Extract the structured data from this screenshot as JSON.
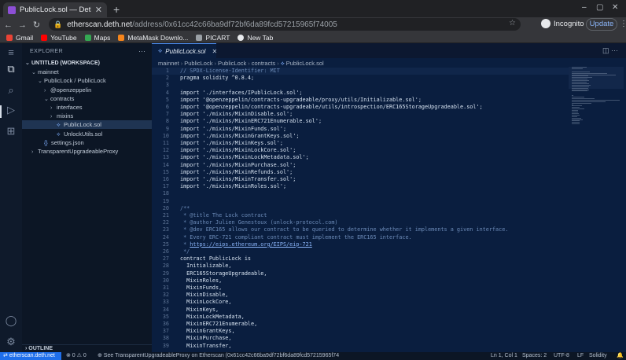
{
  "browser": {
    "tab_title": "PublicLock.sol — DethCode",
    "tab_close": "✕",
    "new_tab": "+",
    "window_controls": {
      "minimize": "–",
      "maximize": "▢",
      "close": "✕"
    },
    "nav": {
      "back": "←",
      "forward": "→",
      "reload": "↻"
    },
    "url_host": "etherscan.deth.net",
    "url_path": "/address/0x61cc42c66ba9df72bf6da89fcd57215965f74005",
    "omnibox_icons": "☆",
    "incognito_label": "Incognito",
    "update_label": "Update",
    "menu": "⋮",
    "bookmarks": [
      {
        "label": "Gmail",
        "color": "#ea4335"
      },
      {
        "label": "YouTube",
        "color": "#ff0000"
      },
      {
        "label": "Maps",
        "color": "#34a853"
      },
      {
        "label": "MetaMask Downlo...",
        "color": "#f6851b"
      },
      {
        "label": "PICART",
        "color": "#9aa0a6"
      },
      {
        "label": "New Tab",
        "color": "#e8eaed"
      }
    ]
  },
  "sidebar": {
    "header": "EXPLORER",
    "dots": "···",
    "rows": [
      {
        "twisty": "⌄",
        "label": "UNTITLED (WORKSPACE)",
        "indent": 0,
        "kind": "ws"
      },
      {
        "twisty": "⌄",
        "label": "mainnet",
        "indent": 1,
        "kind": "folder"
      },
      {
        "twisty": "⌄",
        "label": "PublicLock / PublicLock",
        "indent": 2,
        "kind": "folder"
      },
      {
        "twisty": "›",
        "label": "@openzeppelin",
        "indent": 3,
        "kind": "folder"
      },
      {
        "twisty": "⌄",
        "label": "contracts",
        "indent": 3,
        "kind": "folder"
      },
      {
        "twisty": "›",
        "label": "interfaces",
        "indent": 4,
        "kind": "folder"
      },
      {
        "twisty": "›",
        "label": "mixins",
        "indent": 4,
        "kind": "folder"
      },
      {
        "twisty": "",
        "label": "PublicLock.sol",
        "indent": 4,
        "kind": "file",
        "selected": true
      },
      {
        "twisty": "",
        "label": "UnlockUtils.sol",
        "indent": 4,
        "kind": "file"
      },
      {
        "twisty": "",
        "label": "settings.json",
        "indent": 2,
        "kind": "json"
      },
      {
        "twisty": "›",
        "label": "TransparentUpgradeableProxy",
        "indent": 1,
        "kind": "folder"
      }
    ],
    "outline": "› OUTLINE"
  },
  "editor": {
    "tab_label": "PublicLock.sol",
    "tab_close": "✕",
    "tab_actions": "◫  ···",
    "breadcrumb": [
      "mainnet",
      "PublicLock",
      "PublicLock",
      "contracts",
      "PublicLock.sol"
    ],
    "lines": [
      {
        "n": "1",
        "t": "// SPDX-License-Identifier: MIT",
        "c": "comment"
      },
      {
        "n": "2",
        "t": "pragma solidity ^0.8.4;"
      },
      {
        "n": "3",
        "t": ""
      },
      {
        "n": "4",
        "t": "import './interfaces/IPublicLock.sol';"
      },
      {
        "n": "5",
        "t": "import '@openzeppelin/contracts-upgradeable/proxy/utils/Initializable.sol';"
      },
      {
        "n": "6",
        "t": "import '@openzeppelin/contracts-upgradeable/utils/introspection/ERC165StorageUpgradeable.sol';"
      },
      {
        "n": "7",
        "t": "import './mixins/MixinDisable.sol';"
      },
      {
        "n": "8",
        "t": "import './mixins/MixinERC721Enumerable.sol';"
      },
      {
        "n": "9",
        "t": "import './mixins/MixinFunds.sol';"
      },
      {
        "n": "10",
        "t": "import './mixins/MixinGrantKeys.sol';"
      },
      {
        "n": "11",
        "t": "import './mixins/MixinKeys.sol';"
      },
      {
        "n": "12",
        "t": "import './mixins/MixinLockCore.sol';"
      },
      {
        "n": "13",
        "t": "import './mixins/MixinLockMetadata.sol';"
      },
      {
        "n": "14",
        "t": "import './mixins/MixinPurchase.sol';"
      },
      {
        "n": "15",
        "t": "import './mixins/MixinRefunds.sol';"
      },
      {
        "n": "16",
        "t": "import './mixins/MixinTransfer.sol';"
      },
      {
        "n": "17",
        "t": "import './mixins/MixinRoles.sol';"
      },
      {
        "n": "18",
        "t": ""
      },
      {
        "n": "19",
        "t": ""
      },
      {
        "n": "20",
        "t": "/**",
        "c": "comment"
      },
      {
        "n": "21",
        "t": " * @title The Lock contract",
        "c": "comment"
      },
      {
        "n": "22",
        "t": " * @author Julien Genestoux (unlock-protocol.com)",
        "c": "comment"
      },
      {
        "n": "23",
        "t": " * @dev ERC165 allows our contract to be queried to determine whether it implements a given interface.",
        "c": "comment"
      },
      {
        "n": "24",
        "t": " * Every ERC-721 compliant contract must implement the ERC165 interface.",
        "c": "comment"
      },
      {
        "n": "25",
        "t": " * https://eips.ethereum.org/EIPS/eip-721",
        "c": "comment"
      },
      {
        "n": "26",
        "t": " */",
        "c": "comment"
      },
      {
        "n": "27",
        "t": "contract PublicLock is"
      },
      {
        "n": "28",
        "t": "  Initializable,"
      },
      {
        "n": "29",
        "t": "  ERC165StorageUpgradeable,"
      },
      {
        "n": "30",
        "t": "  MixinRoles,"
      },
      {
        "n": "31",
        "t": "  MixinFunds,"
      },
      {
        "n": "32",
        "t": "  MixinDisable,"
      },
      {
        "n": "33",
        "t": "  MixinLockCore,"
      },
      {
        "n": "34",
        "t": "  MixinKeys,"
      },
      {
        "n": "35",
        "t": "  MixinLockMetadata,"
      },
      {
        "n": "36",
        "t": "  MixinERC721Enumerable,"
      },
      {
        "n": "37",
        "t": "  MixinGrantKeys,"
      },
      {
        "n": "38",
        "t": "  MixinPurchase,"
      },
      {
        "n": "39",
        "t": "  MixinTransfer,"
      }
    ]
  },
  "statusbar": {
    "remote": "⇄ etherscan.deth.net",
    "problems": "⊗ 0  ⚠ 0",
    "message": "⊕ See TransparentUpgradeableProxy on Etherscan (0x61cc42c66ba9df72bf6da89fcd57215965f74",
    "position": "Ln 1, Col 1",
    "spaces": "Spaces: 2",
    "encoding": "UTF-8",
    "eol": "LF",
    "language": "Solidity",
    "bell": "🔔"
  }
}
